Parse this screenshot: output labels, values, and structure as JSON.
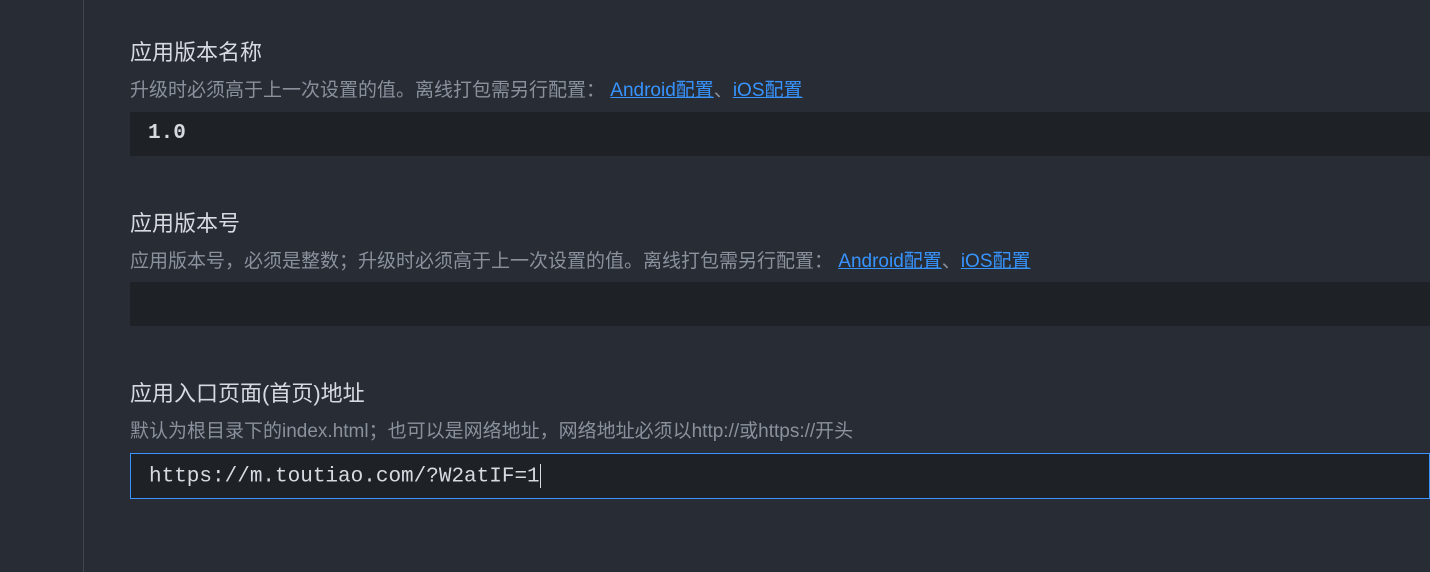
{
  "fields": {
    "versionName": {
      "title": "应用版本名称",
      "description": "升级时必须高于上一次设置的值。离线打包需另行配置：",
      "linkAndroid": "Android配置",
      "separator": "、",
      "linkIOS": "iOS配置",
      "value": "1.0"
    },
    "versionCode": {
      "title": "应用版本号",
      "description": "应用版本号，必须是整数；升级时必须高于上一次设置的值。离线打包需另行配置：",
      "linkAndroid": "Android配置",
      "separator": "、",
      "linkIOS": "iOS配置",
      "value": ""
    },
    "entryUrl": {
      "title": "应用入口页面(首页)地址",
      "description": "默认为根目录下的index.html；也可以是网络地址，网络地址必须以http://或https://开头",
      "value": "https://m.toutiao.com/?W2atIF=1"
    }
  }
}
